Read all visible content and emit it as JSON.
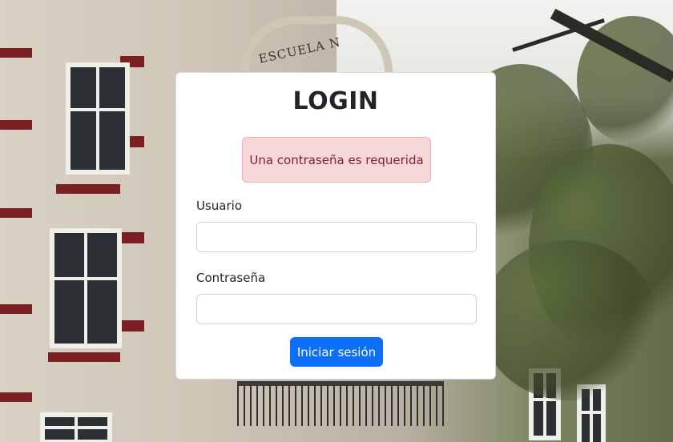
{
  "background": {
    "sign_text": "ESCUELA N"
  },
  "login": {
    "title": "LOGIN",
    "alert": "Una contraseña es requerida",
    "username_label": "Usuario",
    "username_value": "",
    "password_label": "Contraseña",
    "password_value": "",
    "submit_label": "Iniciar sesión"
  },
  "colors": {
    "primary": "#0d6efd",
    "alert_bg": "#f8d7da",
    "alert_text": "#842029",
    "alert_border": "#f1aeb5"
  }
}
